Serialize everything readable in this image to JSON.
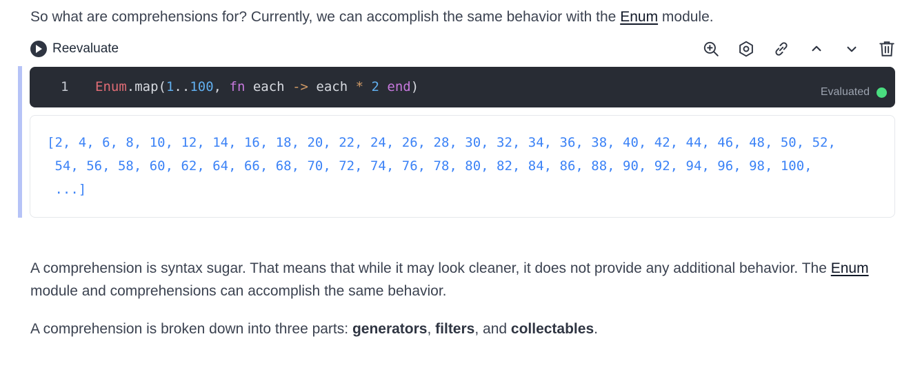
{
  "intro": {
    "before": "So what are comprehensions for? Currently, we can accomplish the same behavior with the ",
    "link": "Enum",
    "after": " module."
  },
  "toolbar": {
    "reevaluate_label": "Reevaluate",
    "icons": [
      "zoom-in-icon",
      "settings-icon",
      "link-icon",
      "chevron-up-icon",
      "chevron-down-icon",
      "trash-icon"
    ]
  },
  "editor": {
    "line_number": "1",
    "tokens": {
      "module": "Enum",
      "call": ".map(",
      "range_start": "1",
      "range_dots": "..",
      "range_end": "100",
      "comma": ", ",
      "fn": "fn",
      "arg": " each ",
      "arrow": "->",
      "expr_var": " each ",
      "times": "*",
      "space": " ",
      "two": "2",
      "end": "end",
      "close": ")"
    },
    "status": "Evaluated",
    "status_color": "#4ade80"
  },
  "output": {
    "line1": "[2, 4, 6, 8, 10, 12, 14, 16, 18, 20, 22, 24, 26, 28, 30, 32, 34, 36, 38, 40, 42, 44, 46, 48, 50, 52,",
    "line2": " 54, 56, 58, 60, 62, 64, 66, 68, 70, 72, 74, 76, 78, 80, 82, 84, 86, 88, 90, 92, 94, 96, 98, 100,",
    "line3": " ...]"
  },
  "para2": {
    "before": "A comprehension is syntax sugar. That means that while it may look cleaner, it does not provide any additional behavior. The ",
    "link": "Enum",
    "after": " module and comprehensions can accomplish the same behavior."
  },
  "para3": {
    "before": "A comprehension is broken down into three parts: ",
    "term1": "generators",
    "sep1": ", ",
    "term2": "filters",
    "sep2": ", and ",
    "term3": "collectables",
    "after": "."
  },
  "colors": {
    "editor_bg": "#282c34",
    "cell_bar": "#b6c3f7",
    "output_text": "#3b82f6"
  }
}
